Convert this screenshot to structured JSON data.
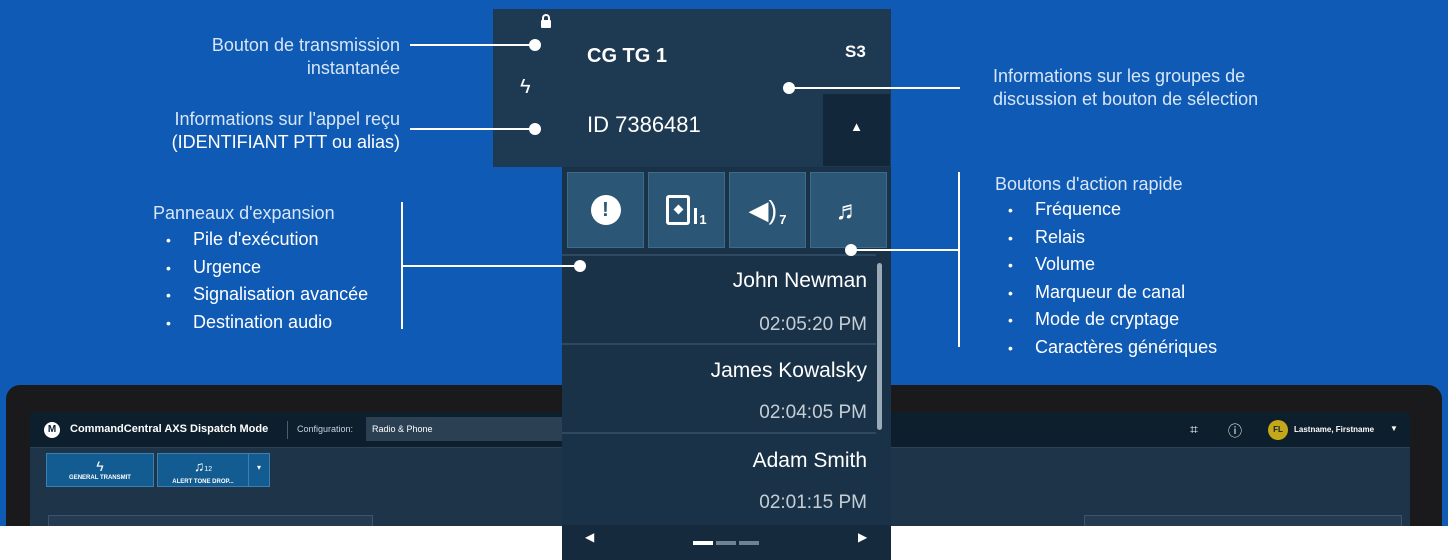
{
  "callouts": {
    "transmit_button_line1": "Bouton de transmission",
    "transmit_button_line2": "instantanée",
    "call_info_line1": "Informations sur l'appel reçu",
    "call_info_line2": "(IDENTIFIANT PTT ou alias)",
    "expansion_panels": {
      "title": "Panneaux d'expansion",
      "items": [
        "Pile d'exécution",
        "Urgence",
        "Signalisation avancée",
        "Destination audio"
      ]
    },
    "talkgroup_info_line1": "Informations sur les groupes de",
    "talkgroup_info_line2": "discussion et bouton de sélection",
    "quick_actions": {
      "title": "Boutons d'action rapide",
      "items": [
        "Fréquence",
        "Relais",
        "Volume",
        "Marqueur de canal",
        "Mode de cryptage",
        "Caractères génériques"
      ]
    }
  },
  "radio": {
    "talkgroup": "CG TG 1",
    "zone": "S3",
    "caller_id": "ID 7386481",
    "relay_count": "1",
    "volume_level": "7",
    "calls": [
      {
        "name": "John Newman",
        "time": "02:05:20 PM"
      },
      {
        "name": "James Kowalsky",
        "time": "02:04:05 PM"
      },
      {
        "name": "Adam Smith",
        "time": "02:01:15 PM"
      }
    ]
  },
  "app": {
    "title": "CommandCentral AXS Dispatch Mode",
    "configuration_label": "Configuration:",
    "configuration_value": "Radio & Phone",
    "user_initials": "FL",
    "user_name": "Lastname, Firstname",
    "general_transmit_label": "GENERAL TRANSMIT",
    "alert_tone_label": "ALERT TONE DROP...",
    "alert_tone_count": "12"
  },
  "colors": {
    "background": "#0f5ab5",
    "radio_panel": "#1e3a52",
    "quick_action_button": "#2b5676",
    "toolbar_button": "#125c92"
  }
}
